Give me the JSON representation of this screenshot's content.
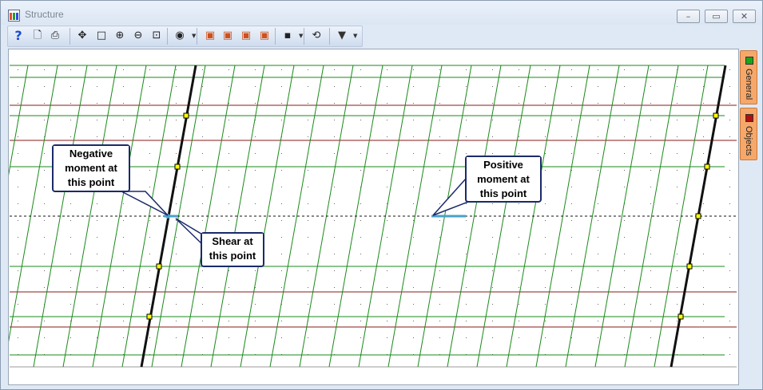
{
  "window": {
    "title": "Structure"
  },
  "toolbar": {
    "buttons": [
      {
        "name": "help-button",
        "icon": "help-icon",
        "glyph": "?"
      },
      {
        "name": "print-preview-button",
        "icon": "print-preview-icon",
        "glyph": "🗋"
      },
      {
        "name": "print-button",
        "icon": "printer-icon",
        "glyph": "⎙"
      },
      {
        "name": "pan-button",
        "icon": "move-icon",
        "glyph": "✥"
      },
      {
        "name": "select-window-button",
        "icon": "rectangle-icon",
        "glyph": "□"
      },
      {
        "name": "zoom-in-button",
        "icon": "zoom-in-icon",
        "glyph": "⊕"
      },
      {
        "name": "zoom-out-button",
        "icon": "zoom-out-icon",
        "glyph": "⊖"
      },
      {
        "name": "zoom-extents-button",
        "icon": "zoom-extents-icon",
        "glyph": "⊡"
      },
      {
        "name": "view-button",
        "icon": "eye-icon",
        "glyph": "◉"
      },
      {
        "name": "view-3d-front-button",
        "icon": "cube-icon",
        "glyph": "▣"
      },
      {
        "name": "view-3d-side-button",
        "icon": "cube-icon",
        "glyph": "▣"
      },
      {
        "name": "view-3d-top-button",
        "icon": "cube-icon",
        "glyph": "▣"
      },
      {
        "name": "view-3d-iso-button",
        "icon": "cube-icon",
        "glyph": "▣"
      },
      {
        "name": "save-button",
        "icon": "floppy-icon",
        "glyph": "▪"
      },
      {
        "name": "refresh-button",
        "icon": "refresh-icon",
        "glyph": "⟲"
      },
      {
        "name": "filter-button",
        "icon": "filter-icon",
        "glyph": "▼"
      }
    ]
  },
  "side_tabs": [
    {
      "label": "General",
      "color": "#1aa51a"
    },
    {
      "label": "Objects",
      "color": "#b01010"
    }
  ],
  "callouts": {
    "negative": [
      "Negative",
      "moment at",
      "this point"
    ],
    "shear": [
      "Shear at",
      "this point"
    ],
    "positive": [
      "Positive",
      "moment at",
      "this point"
    ]
  },
  "colors": {
    "grid_green": "#1a8a1a",
    "beam_red": "#8a1a1a",
    "diagram_blue": "#4aa0c8",
    "callout_border": "#1a2a6a",
    "tab_orange": "#f6a86a"
  }
}
